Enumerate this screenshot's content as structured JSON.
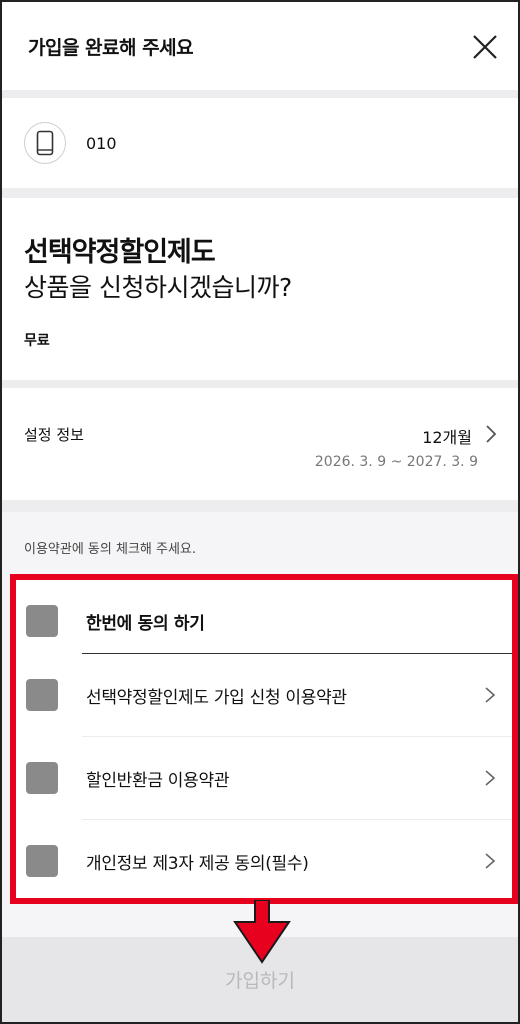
{
  "header": {
    "title": "가입을 완료해 주세요",
    "close_icon": "close-icon"
  },
  "phone": {
    "icon": "smartphone-icon",
    "number": "010"
  },
  "product": {
    "name": "선택약정할인제도",
    "question": "상품을 신청하시겠습니까?",
    "price": "무료"
  },
  "settings": {
    "label": "설정 정보",
    "value": "12개월",
    "period": "2026. 3. 9 ~ 2027. 3. 9"
  },
  "terms": {
    "hint": "이용약관에 동의 체크해 주세요.",
    "all_label": "한번에 동의 하기",
    "items": [
      {
        "label": "선택약정할인제도 가입 신청 이용약관"
      },
      {
        "label": "할인반환금 이용약관"
      },
      {
        "label": "개인정보 제3자 제공 동의(필수)"
      }
    ]
  },
  "join_button": {
    "label": "가입하기"
  },
  "colors": {
    "highlight": "#e8001f",
    "checkbox": "#8a8a8a",
    "disabled_text": "#b8b8bd"
  }
}
